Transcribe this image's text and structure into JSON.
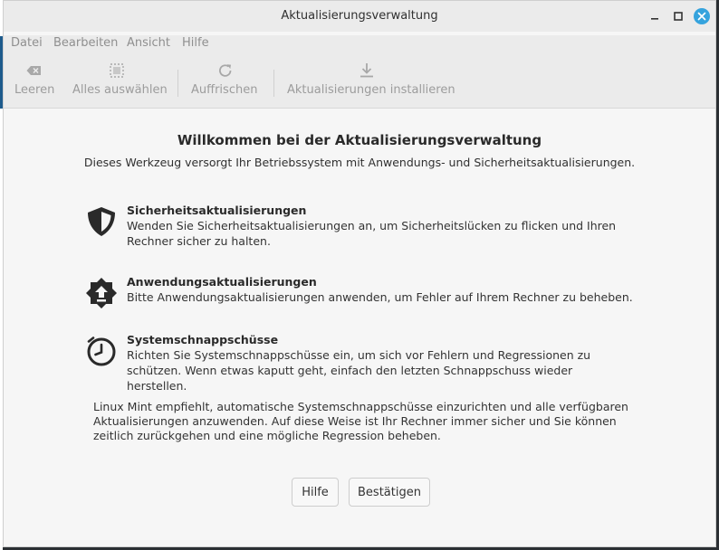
{
  "window": {
    "title": "Aktualisierungsverwaltung"
  },
  "menu": {
    "items": [
      "Datei",
      "Bearbeiten",
      "Ansicht",
      "Hilfe"
    ]
  },
  "toolbar": {
    "clear_label": "Leeren",
    "select_all_label": "Alles auswählen",
    "refresh_label": "Auffrischen",
    "install_label": "Aktualisierungen installieren"
  },
  "welcome": {
    "title": "Willkommen bei der Aktualisierungsverwaltung",
    "subtitle": "Dieses Werkzeug versorgt Ihr Betriebssystem mit Anwendungs- und Sicherheitsaktualisierungen.",
    "features": [
      {
        "icon": "shield-icon",
        "title": "Sicherheitsaktualisierungen",
        "description": "Wenden Sie Sicherheitsaktualisierungen an, um Sicherheitslücken zu flicken und Ihren Rechner sicher zu halten."
      },
      {
        "icon": "package-update-icon",
        "title": "Anwendungsaktualisierungen",
        "description": "Bitte Anwendungsaktualisierungen anwenden, um Fehler auf Ihrem Rechner zu beheben."
      },
      {
        "icon": "clock-icon",
        "title": "Systemschnappschüsse",
        "description": "Richten Sie Systemschnappschüsse ein, um sich vor Fehlern und Regressionen zu schützen. Wenn etwas kaputt geht, einfach den letzten Schnappschuss wieder herstellen."
      }
    ],
    "note": "Linux Mint empfiehlt, automatische Systemschnappschüsse einzurichten und alle verfügbaren Aktualisierungen anzuwenden. Auf diese Weise ist Ihr Rechner immer sicher und Sie können zeitlich zurückgehen und eine mögliche Regression beheben.",
    "help_button": "Hilfe",
    "confirm_button": "Bestätigen"
  },
  "colors": {
    "accent": "#35a3dd",
    "window_bg": "#f6f6f6",
    "titlebar_bg": "#ebebeb"
  }
}
